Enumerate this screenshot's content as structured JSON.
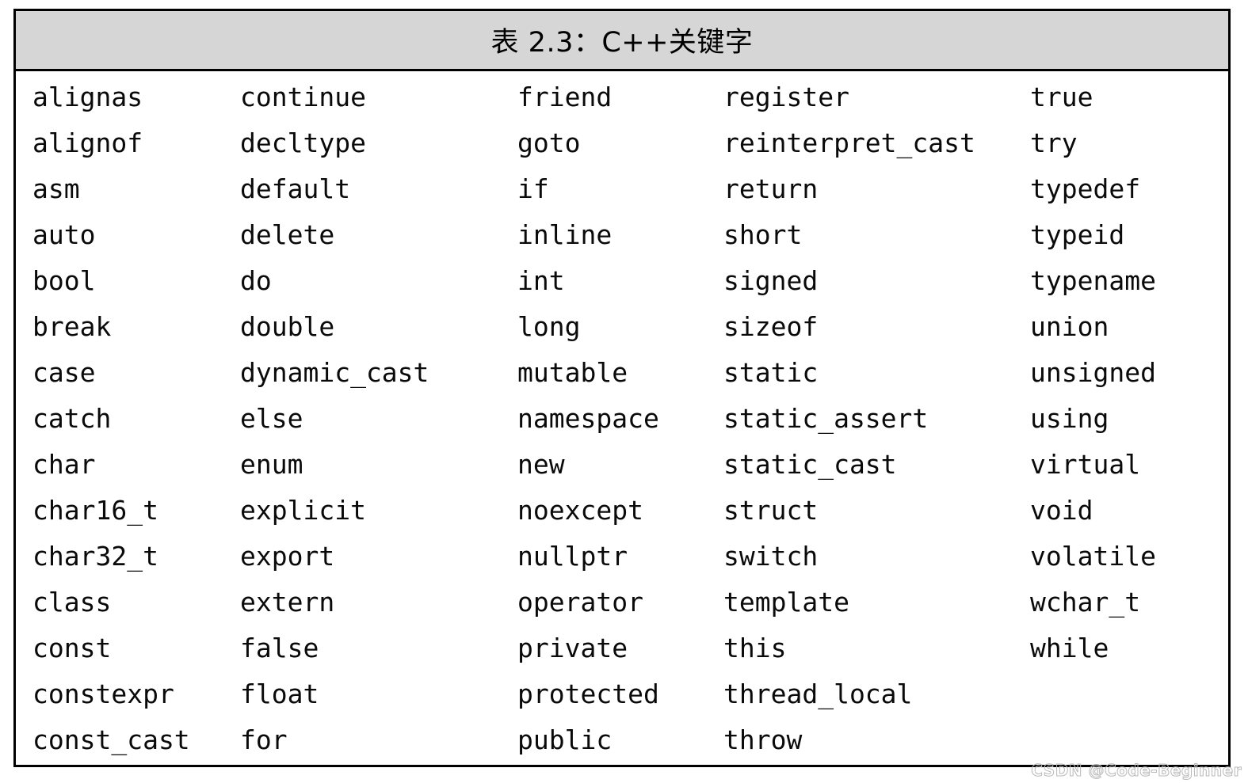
{
  "table": {
    "caption": "表 2.3：C++关键字",
    "header_background": "#d6d6d6",
    "border_color": "#000000",
    "columns": [
      {
        "index": 1,
        "keywords": [
          "alignas",
          "alignof",
          "asm",
          "auto",
          "bool",
          "break",
          "case",
          "catch",
          "char",
          "char16_t",
          "char32_t",
          "class",
          "const",
          "constexpr",
          "const_cast"
        ]
      },
      {
        "index": 2,
        "keywords": [
          "continue",
          "decltype",
          "default",
          "delete",
          "do",
          "double",
          "dynamic_cast",
          "else",
          "enum",
          "explicit",
          "export",
          "extern",
          "false",
          "float",
          "for"
        ]
      },
      {
        "index": 3,
        "keywords": [
          "friend",
          "goto",
          "if",
          "inline",
          "int",
          "long",
          "mutable",
          "namespace",
          "new",
          "noexcept",
          "nullptr",
          "operator",
          "private",
          "protected",
          "public"
        ]
      },
      {
        "index": 4,
        "keywords": [
          "register",
          "reinterpret_cast",
          "return",
          "short",
          "signed",
          "sizeof",
          "static",
          "static_assert",
          "static_cast",
          "struct",
          "switch",
          "template",
          "this",
          "thread_local",
          "throw"
        ]
      },
      {
        "index": 5,
        "keywords": [
          "true",
          "try",
          "typedef",
          "typeid",
          "typename",
          "union",
          "unsigned",
          "using",
          "virtual",
          "void",
          "volatile",
          "wchar_t",
          "while"
        ]
      }
    ]
  },
  "watermark": {
    "text": "CSDN @Code-Beginner"
  }
}
